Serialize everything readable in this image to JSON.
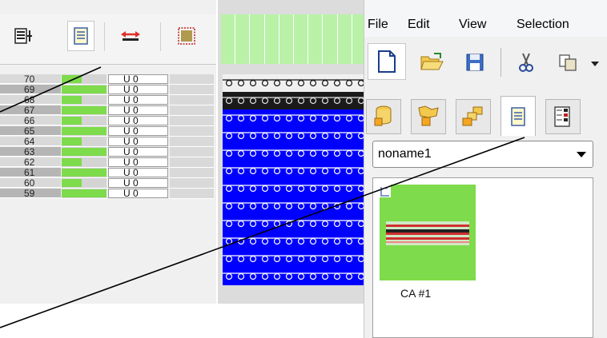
{
  "left_panel": {
    "toolbar_icons": [
      "list-insert-icon",
      "pattern-doc-icon",
      "swap-arrows-icon",
      "texture-square-icon"
    ],
    "rows": [
      {
        "number": "70",
        "fill": 0.45,
        "value": "U 0"
      },
      {
        "number": "69",
        "fill": 1.0,
        "value": "U 0"
      },
      {
        "number": "68",
        "fill": 0.45,
        "value": "U 0"
      },
      {
        "number": "67",
        "fill": 1.0,
        "value": "U 0"
      },
      {
        "number": "66",
        "fill": 0.45,
        "value": "U 0"
      },
      {
        "number": "65",
        "fill": 1.0,
        "value": "U 0"
      },
      {
        "number": "64",
        "fill": 0.45,
        "value": "U 0"
      },
      {
        "number": "63",
        "fill": 1.0,
        "value": "U 0"
      },
      {
        "number": "62",
        "fill": 0.45,
        "value": "U 0"
      },
      {
        "number": "61",
        "fill": 1.0,
        "value": "U 0"
      },
      {
        "number": "60",
        "fill": 0.45,
        "value": "U 0"
      },
      {
        "number": "59",
        "fill": 1.0,
        "value": "U 0"
      }
    ]
  },
  "pattern": {
    "row_colors": [
      "#f0f0f0",
      "#1a1a1a",
      "#0000ff",
      "#0000ff",
      "#0000ff",
      "#0000ff",
      "#0000ff",
      "#0000ff",
      "#0000ff",
      "#0000ff",
      "#0000ff",
      "#0000ff"
    ],
    "accent_green": "#b9f2a7"
  },
  "menubar": {
    "items": [
      "File",
      "Edit",
      "View",
      "Selection"
    ]
  },
  "toolbar": {
    "icons": [
      "new-document-icon",
      "open-folder-icon",
      "save-icon",
      "cut-icon",
      "copy-icon",
      "more-arrow-icon"
    ]
  },
  "tabs": {
    "icons": [
      "yarn-database-icon",
      "stitch-library-icon",
      "shapes-icon",
      "pattern-doc-icon",
      "chart-icon"
    ],
    "active_index": 3
  },
  "dropdown": {
    "value": "noname1"
  },
  "document": {
    "thumbnail_label": "CA #1"
  }
}
